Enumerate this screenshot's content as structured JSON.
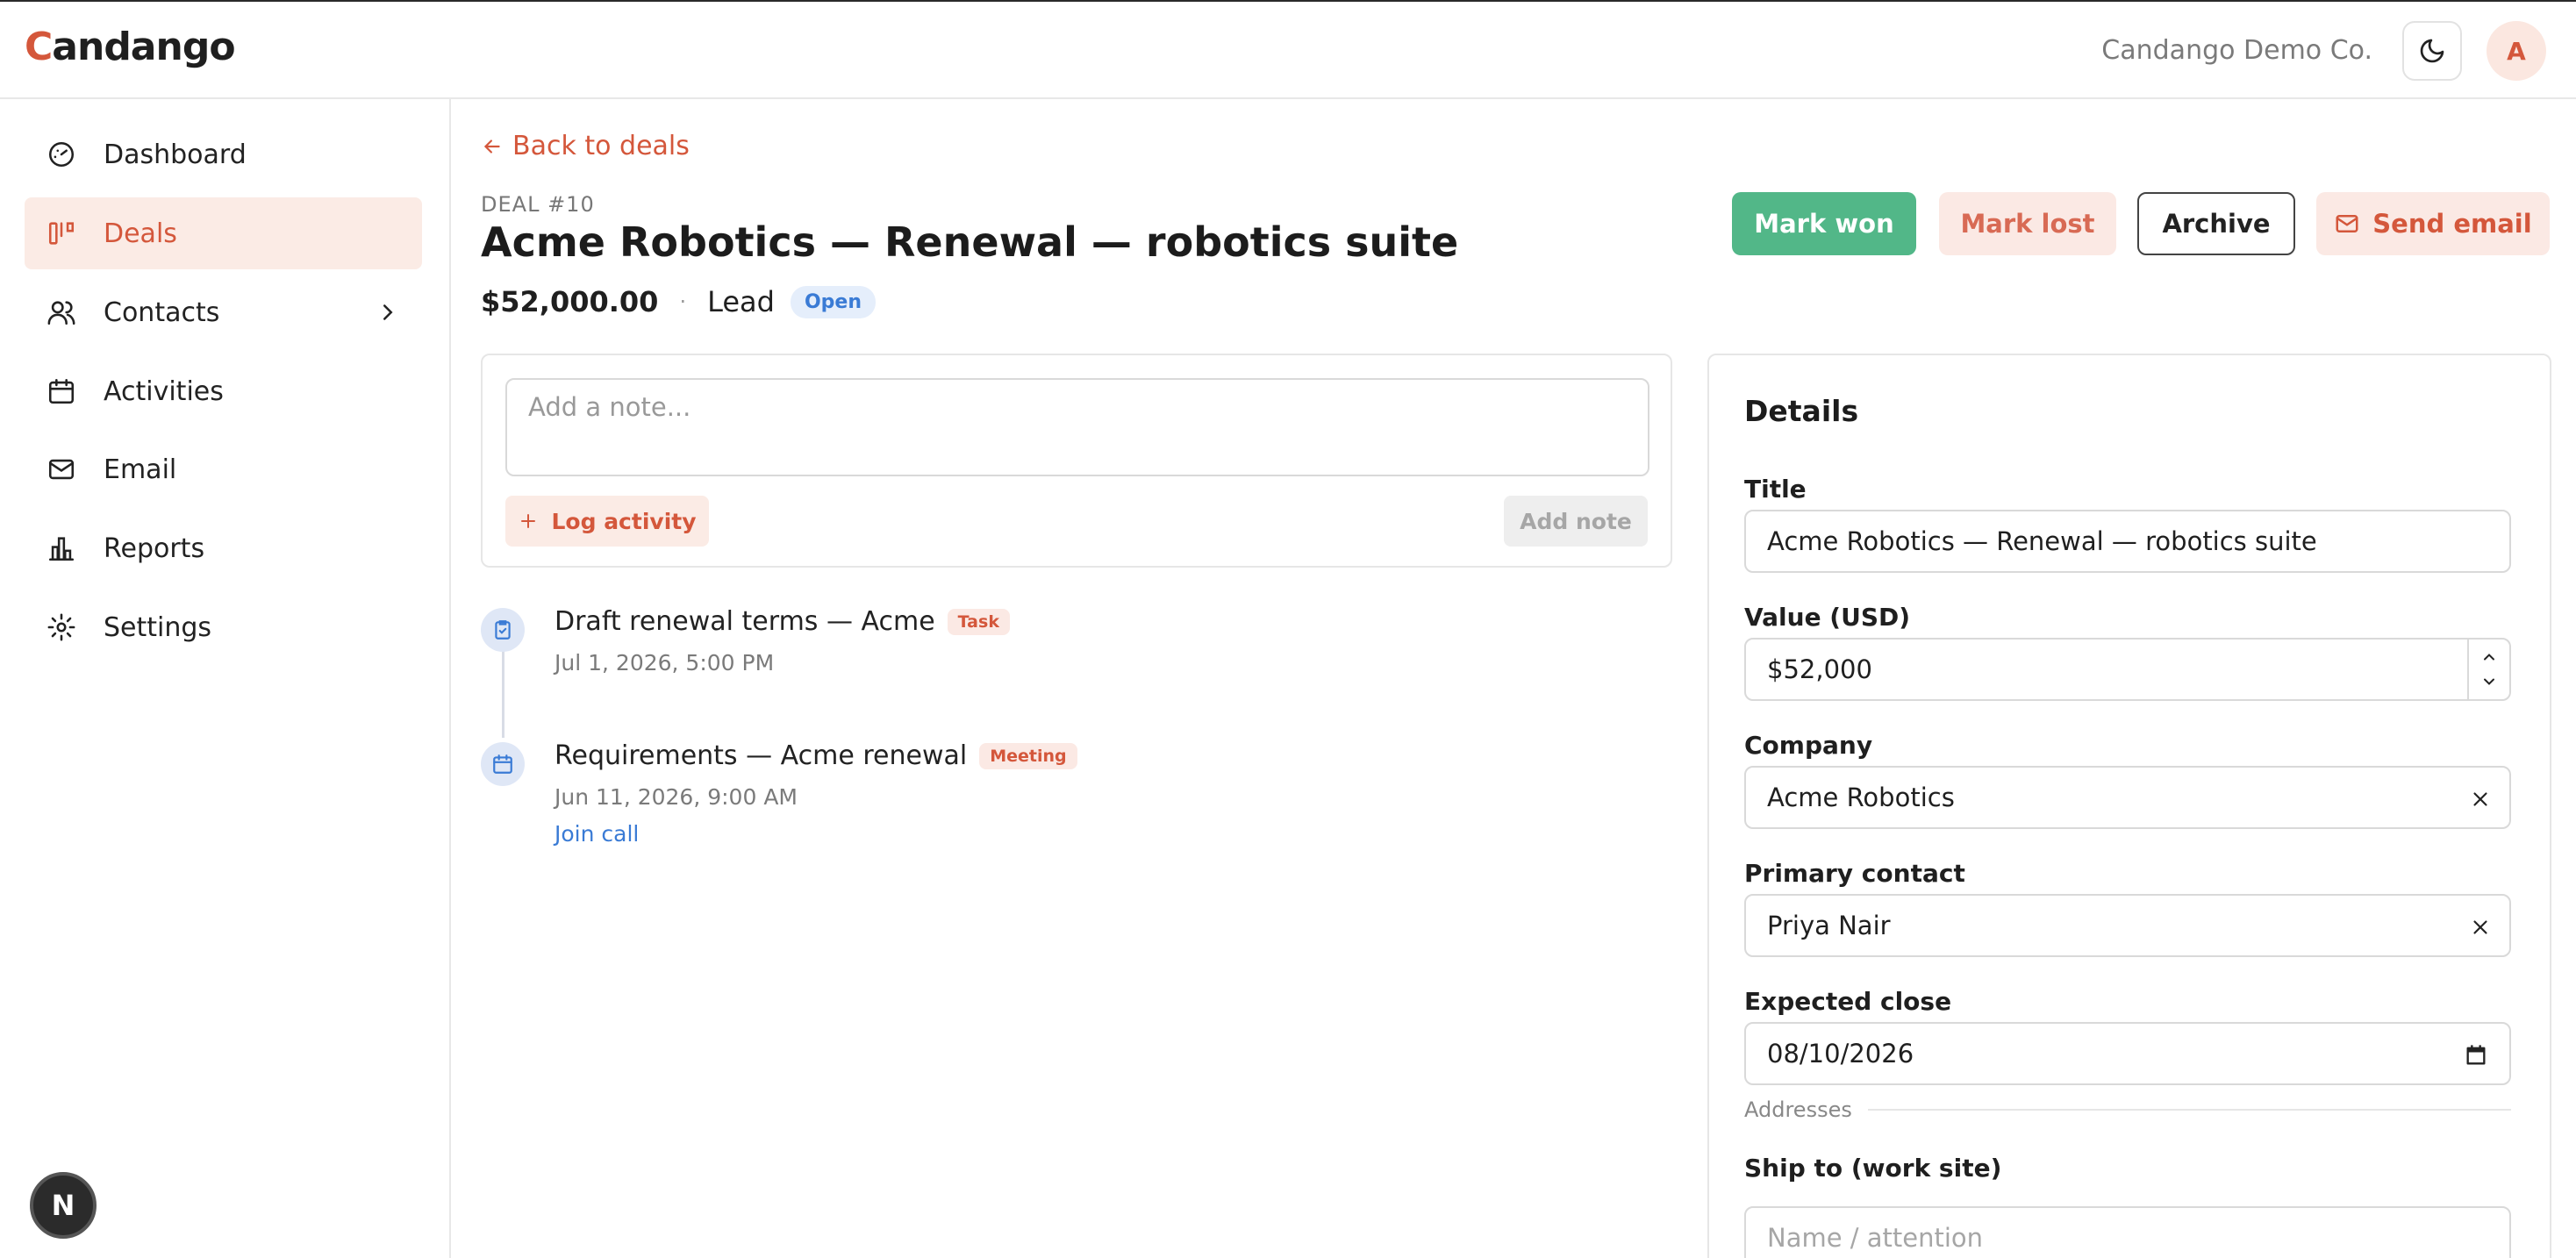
{
  "header": {
    "logo_first": "C",
    "logo_rest": "andango",
    "company": "Candango Demo Co.",
    "avatar_initial": "A"
  },
  "sidebar": {
    "items": [
      {
        "label": "Dashboard",
        "icon": "gauge-icon"
      },
      {
        "label": "Deals",
        "icon": "kanban-icon",
        "active": true
      },
      {
        "label": "Contacts",
        "icon": "users-icon"
      },
      {
        "label": "Activities",
        "icon": "calendar-icon"
      },
      {
        "label": "Email",
        "icon": "mail-icon"
      },
      {
        "label": "Reports",
        "icon": "bar-chart-icon"
      },
      {
        "label": "Settings",
        "icon": "gear-icon"
      }
    ]
  },
  "deal": {
    "back_label": "Back to deals",
    "number": "DEAL #10",
    "title": "Acme Robotics — Renewal — robotics suite",
    "amount": "$52,000.00",
    "separator": "·",
    "stage": "Lead",
    "status": "Open"
  },
  "actions": {
    "mark_won": "Mark won",
    "mark_lost": "Mark lost",
    "archive": "Archive",
    "send_email": "Send email"
  },
  "composer": {
    "placeholder": "Add a note...",
    "log_activity": "Log activity",
    "add_note": "Add note"
  },
  "timeline": [
    {
      "title": "Draft renewal terms — Acme",
      "tag": "Task",
      "time": "Jul 1, 2026, 5:00 PM"
    },
    {
      "title": "Requirements — Acme renewal",
      "tag": "Meeting",
      "time": "Jun 11, 2026, 9:00 AM",
      "link": "Join call"
    }
  ],
  "details": {
    "heading": "Details",
    "title_label": "Title",
    "title_value": "Acme Robotics — Renewal — robotics suite",
    "value_label": "Value (USD)",
    "value_value": "$52,000",
    "company_label": "Company",
    "company_value": "Acme Robotics",
    "contact_label": "Primary contact",
    "contact_value": "Priya Nair",
    "close_label": "Expected close",
    "close_value": "08/10/2026",
    "addresses_label": "Addresses",
    "ship_label": "Ship to (work site)",
    "ship_placeholder": "Name / attention"
  },
  "dev_badge": "N",
  "colors": {
    "accent": "#d4573b",
    "success": "#52b788",
    "link": "#3a7bd5"
  }
}
